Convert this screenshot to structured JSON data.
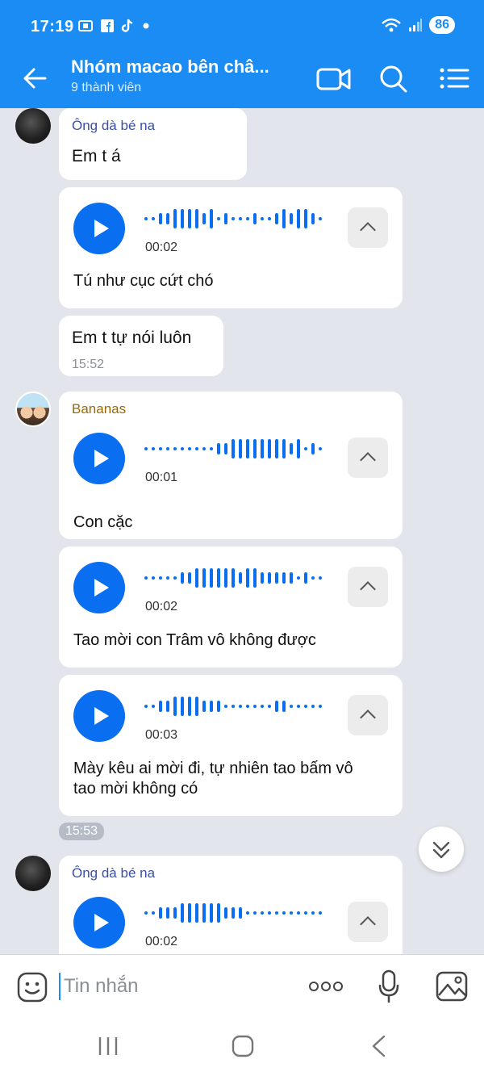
{
  "status_bar": {
    "time": "17:19",
    "battery": "86"
  },
  "header": {
    "title": "Nhóm macao bên châ...",
    "subtitle": "9 thành viên"
  },
  "messages": [
    {
      "sender": "Ông dà bé na",
      "text": "Em t á"
    },
    {
      "voice_duration": "00:02",
      "transcript": "Tú như cục cứt chó"
    },
    {
      "text": "Em t tự nói luôn",
      "time": "15:52"
    },
    {
      "sender": "Bananas",
      "voice_duration": "00:01",
      "transcript": "Con cặc"
    },
    {
      "voice_duration": "00:02",
      "transcript": "Tao mời con Trâm vô không được"
    },
    {
      "voice_duration": "00:03",
      "transcript": "Mày kêu ai mời đi, tự nhiên tao bấm vô tao mời không có"
    },
    {
      "sender": "Ông dà bé na",
      "voice_duration": "00:02"
    }
  ],
  "time_separator": "15:53",
  "composer": {
    "placeholder": "Tin nhắn"
  },
  "colors": {
    "header": "#1a8cf3",
    "accent": "#0a6ef0",
    "background": "#e2e6ec"
  },
  "icons": [
    "back-arrow-icon",
    "video-call-icon",
    "search-icon",
    "menu-list-icon",
    "play-icon",
    "chevron-up-icon",
    "double-chevron-down-icon",
    "sticker-icon",
    "more-dots-icon",
    "microphone-icon",
    "image-icon"
  ]
}
